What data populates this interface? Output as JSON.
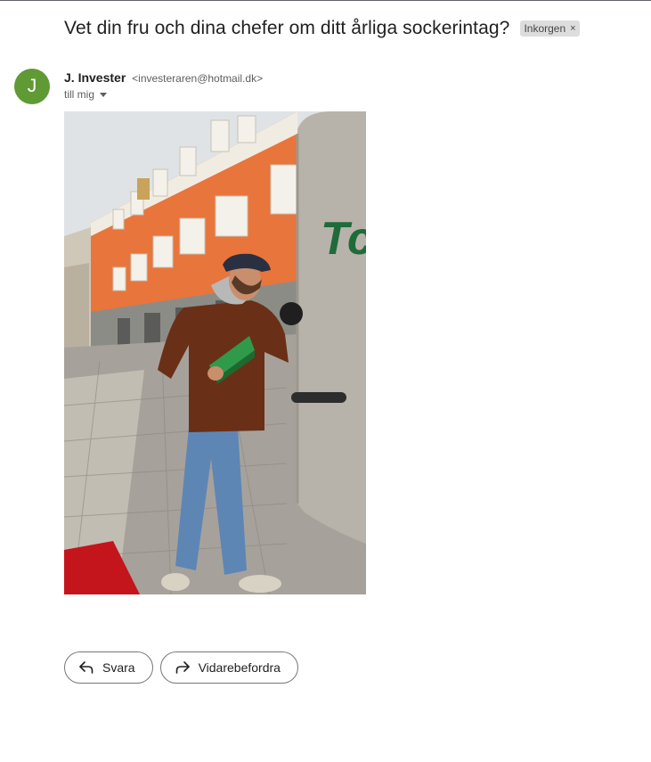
{
  "email": {
    "subject": "Vet din fru och dina chefer om ditt årliga sockerintag?",
    "label": "Inkorgen",
    "label_remove_glyph": "×",
    "sender": {
      "avatar_initial": "J",
      "avatar_color": "#5f9a35",
      "name": "J. Invester",
      "email": "<investeraren@hotmail.dk>"
    },
    "recipient_text": "till mig",
    "attachment_image": {
      "description_icon": "photo-image"
    }
  },
  "actions": {
    "reply_label": "Svara",
    "forward_label": "Vidarebefordra"
  }
}
